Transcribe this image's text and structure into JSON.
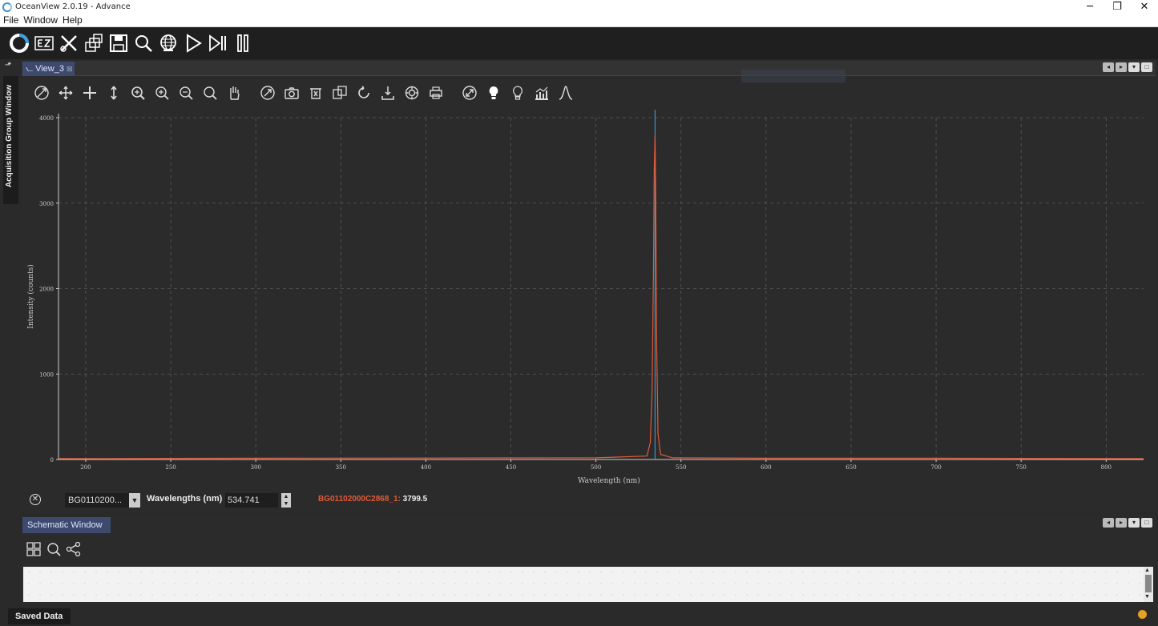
{
  "window": {
    "title": "OceanView 2.0.19 - Advance",
    "minimize": "─",
    "restore": "❐",
    "close": "✕"
  },
  "menu": {
    "items": [
      {
        "label": "File"
      },
      {
        "label": "Window"
      },
      {
        "label": "Help"
      }
    ]
  },
  "side_tab": {
    "label": "Acquisition Group Window"
  },
  "view": {
    "tab_label": "View_3",
    "tab_close": "⊠"
  },
  "readout": {
    "device": "BG0110200...",
    "wavelength_label": "Wavelengths (nm)",
    "wavelength_value": "534.741",
    "series_name": "BG01102000C2868_1:",
    "series_value": "3799.5"
  },
  "schematic": {
    "tab_label": "Schematic Window"
  },
  "saved_data": {
    "label": "Saved Data"
  },
  "colors": {
    "background": "#2a2a2a",
    "series": "#e05a3a",
    "cursor": "#3ea8d8",
    "accent_tab": "#3d4a6e",
    "status": "#e8a020"
  },
  "chart_data": {
    "type": "line",
    "xlabel": "Wavelength (nm)",
    "ylabel": "Intensity (counts)",
    "xlim": [
      184,
      822
    ],
    "ylim": [
      0,
      4000
    ],
    "x_ticks": [
      200,
      250,
      300,
      350,
      400,
      450,
      500,
      550,
      600,
      650,
      700,
      750,
      800
    ],
    "y_ticks": [
      0,
      1000,
      2000,
      3000,
      4000
    ],
    "grid": true,
    "cursor_x": 534.741,
    "series": [
      {
        "name": "BG01102000C2868_1",
        "x": [
          184,
          300,
          500,
          530,
          532,
          533,
          533.8,
          534.3,
          534.741,
          535.2,
          535.7,
          536.5,
          538,
          545,
          600,
          700,
          822
        ],
        "y": [
          10,
          15,
          20,
          40,
          200,
          800,
          2200,
          3400,
          3799.5,
          3000,
          1350,
          300,
          60,
          20,
          15,
          15,
          10
        ]
      }
    ]
  }
}
